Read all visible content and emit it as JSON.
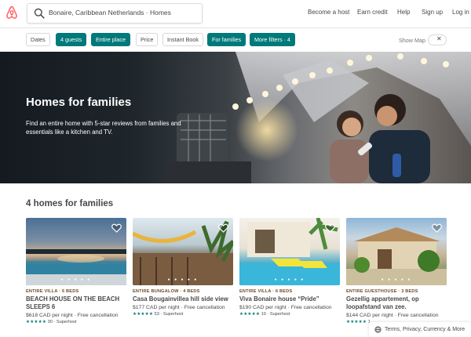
{
  "header": {
    "search_value": "Bonaire, Caribbean Netherlands · Homes",
    "nav": [
      "Become a host",
      "Earn credit",
      "Help",
      "Sign up",
      "Log in"
    ]
  },
  "filters": {
    "chips": [
      {
        "label": "Dates",
        "active": false
      },
      {
        "label": "4 guests",
        "active": true
      },
      {
        "label": "Entire place",
        "active": true
      },
      {
        "label": "Price",
        "active": false
      },
      {
        "label": "Instant Book",
        "active": false
      },
      {
        "label": "For families",
        "active": true
      },
      {
        "label": "More filters · 4",
        "active": true
      }
    ],
    "show_map": "Show Map",
    "toggle_glyph": "✕"
  },
  "hero": {
    "title": "Homes for families",
    "subtitle": "Find an entire home with 5-star reviews from families and essentials like a kitchen and TV."
  },
  "section": {
    "title": "4 homes for families"
  },
  "listings": [
    {
      "type": "ENTIRE VILLA · 6 BEDS",
      "name": "BEACH HOUSE ON THE BEACH SLEEPS 6",
      "price": "$618 CAD  per night · Free cancellation",
      "stars": "★★★★★",
      "rating": "30 · Superhost"
    },
    {
      "type": "ENTIRE BUNGALOW · 4 BEDS",
      "name": "Casa Bougainvillea hill side view",
      "price": "$177 CAD  per night · Free cancellation",
      "stars": "★★★★★",
      "rating": "53 · Superhost"
    },
    {
      "type": "ENTIRE VILLA · 6 BEDS",
      "name": "Viva Bonaire house “Pride”",
      "price": "$190 CAD  per night · Free cancellation",
      "stars": "★★★★★",
      "rating": "10 · Superhost"
    },
    {
      "type": "ENTIRE GUESTHOUSE · 3 BEDS",
      "name": "Gezellig appartement, op loopafstand van zee.",
      "price": "$144 CAD  per night · Free cancellation",
      "stars": "★★★★★",
      "rating": "1"
    }
  ],
  "footer": {
    "label": "Terms, Privacy, Currency & More"
  },
  "colors": {
    "accent": "#00797a",
    "brand": "#ff5a5f",
    "type_label": "#6b4b2a"
  }
}
